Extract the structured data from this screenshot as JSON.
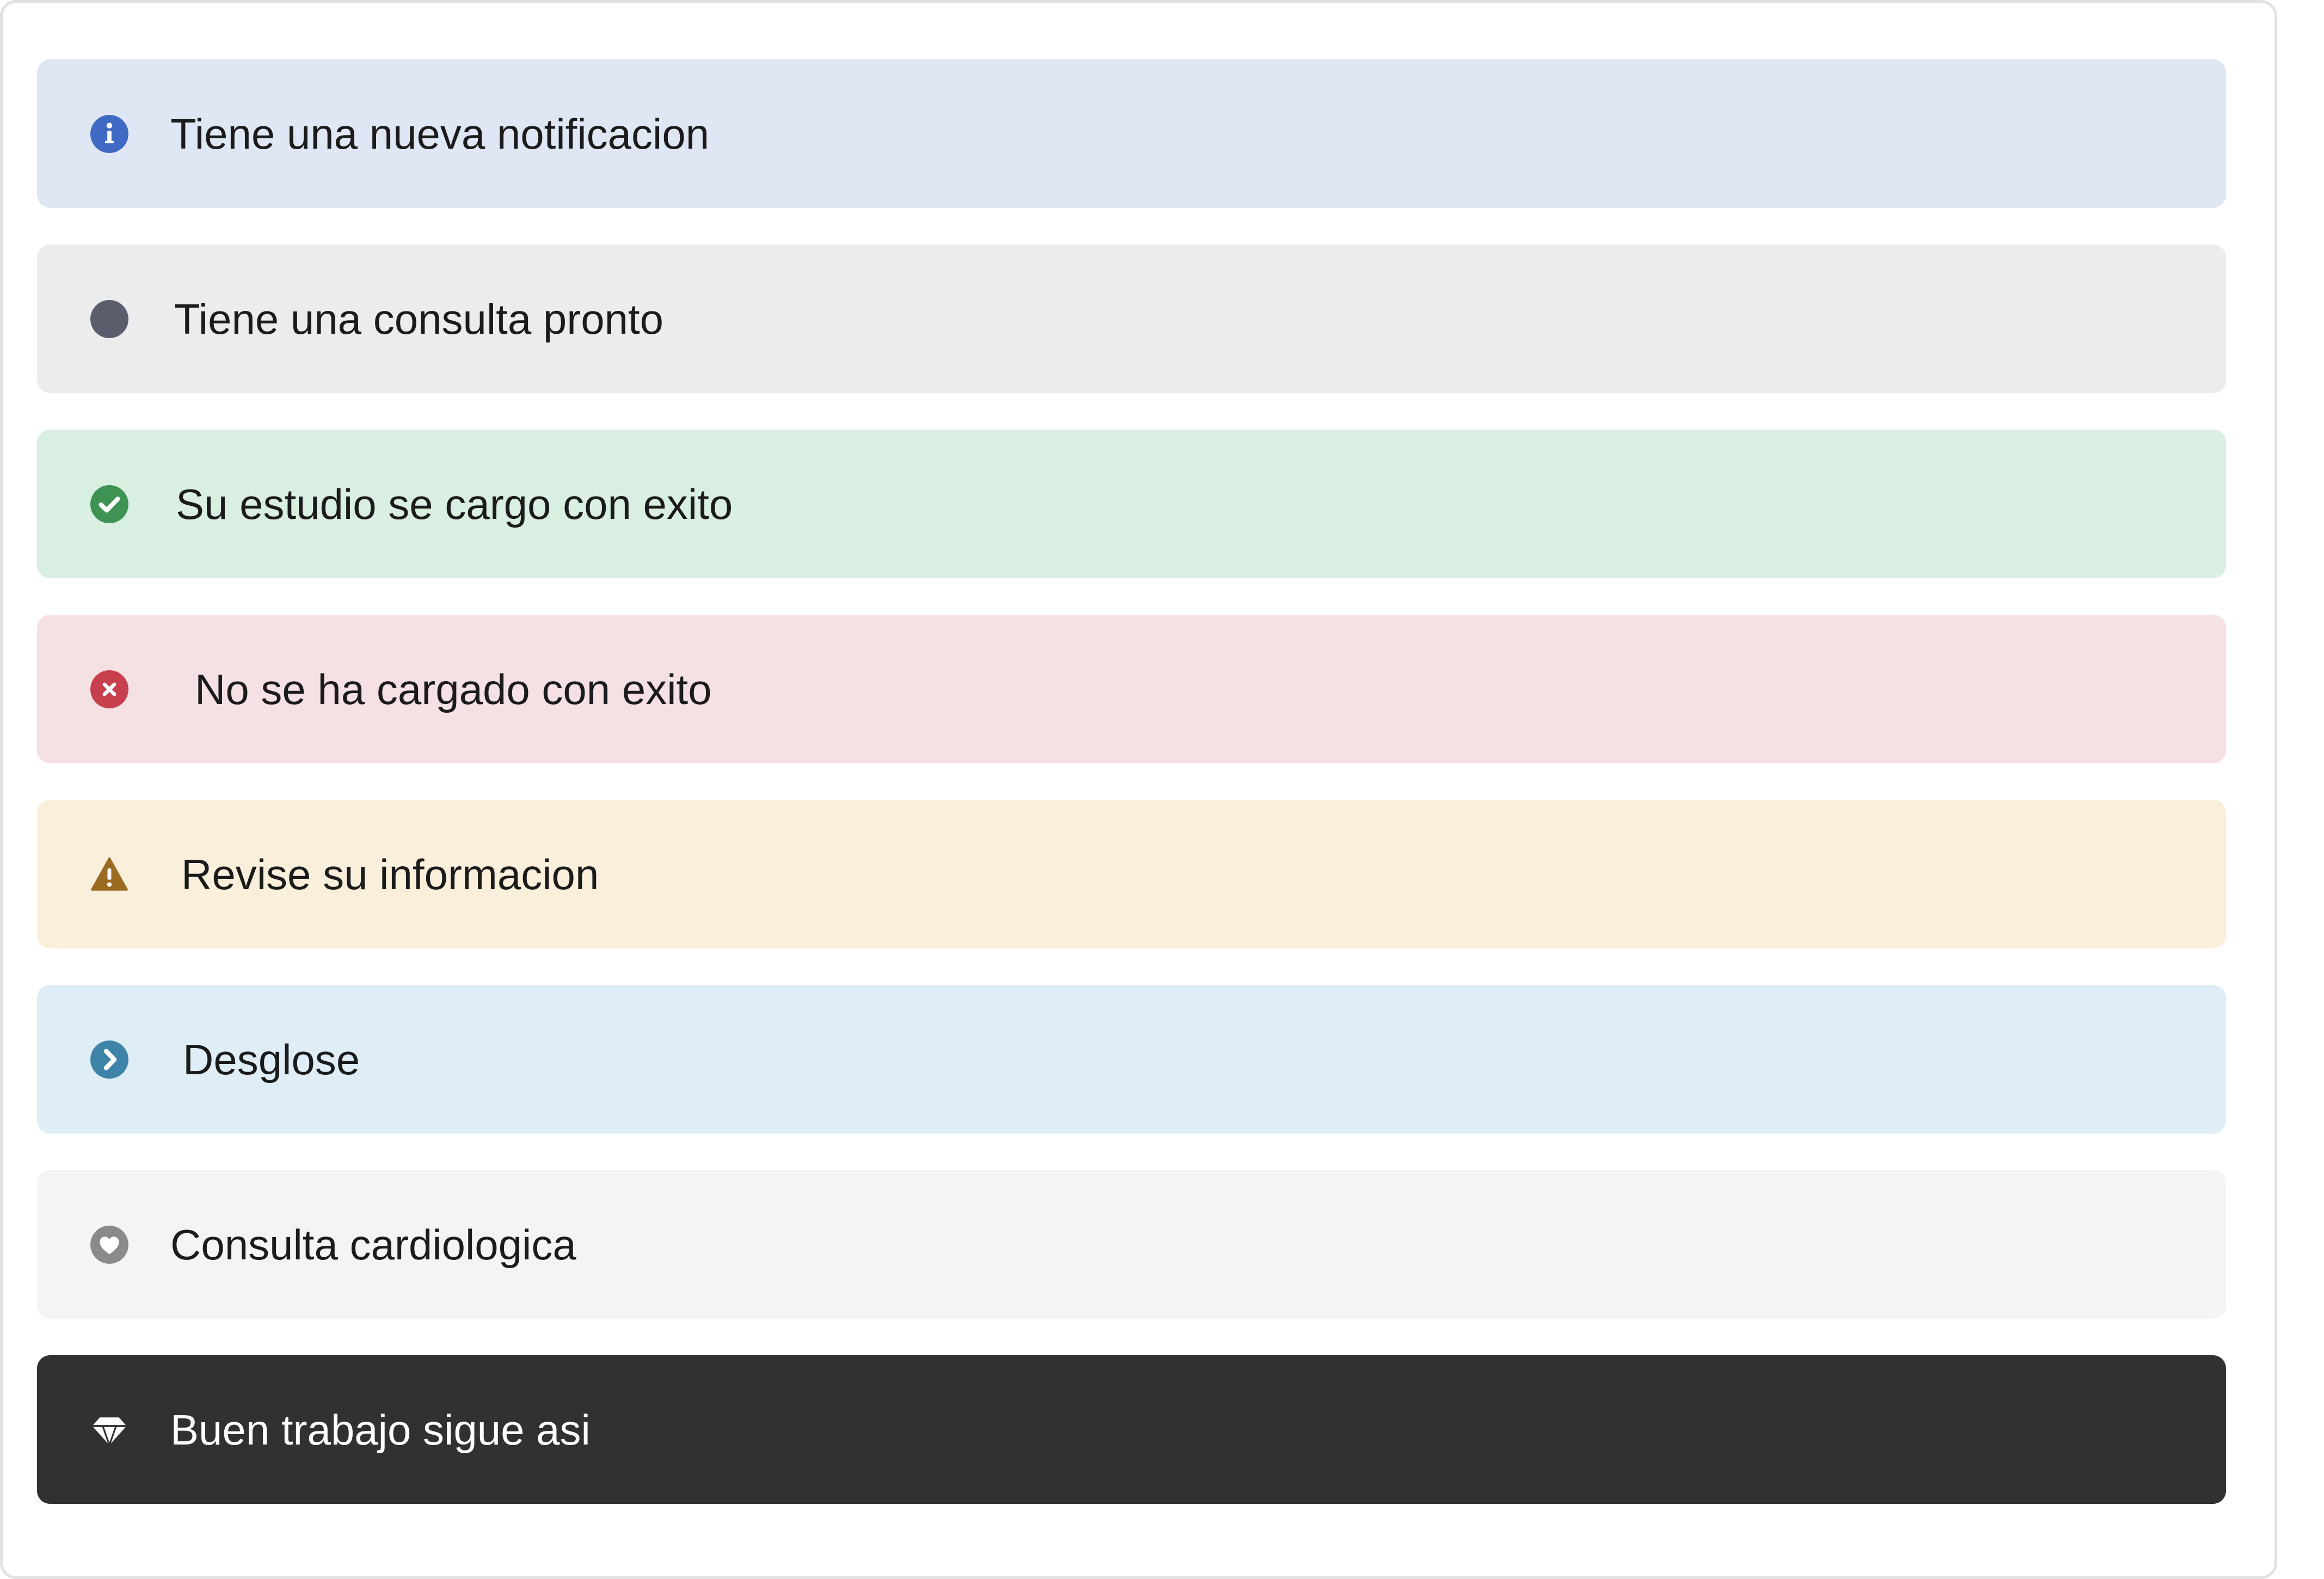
{
  "alerts": [
    {
      "variant": "primary",
      "icon": "info-icon",
      "icon_color": "#3e6ac4",
      "text": "Tiene una nueva notificacion"
    },
    {
      "variant": "secondary",
      "icon": "dot-icon",
      "icon_color": "#5a5e6c",
      "text": "Tiene una consulta pronto"
    },
    {
      "variant": "success",
      "icon": "check-circle-icon",
      "icon_color": "#3e9253",
      "text": "Su estudio se cargo con exito"
    },
    {
      "variant": "danger",
      "icon": "x-circle-icon",
      "icon_color": "#c8404d",
      "text": "No se ha cargado con exito"
    },
    {
      "variant": "warning",
      "icon": "warning-triangle-icon",
      "icon_color": "#9a6b21",
      "text": "Revise su informacion"
    },
    {
      "variant": "info",
      "icon": "chevron-right-circle-icon",
      "icon_color": "#3d84a8",
      "text": "Desglose"
    },
    {
      "variant": "light",
      "icon": "heart-circle-icon",
      "icon_color": "#8a8a8a",
      "text": "Consulta cardiologica"
    },
    {
      "variant": "dark",
      "icon": "diamond-icon",
      "icon_color": "#ffffff",
      "text": "Buen trabajo sigue asi"
    }
  ]
}
